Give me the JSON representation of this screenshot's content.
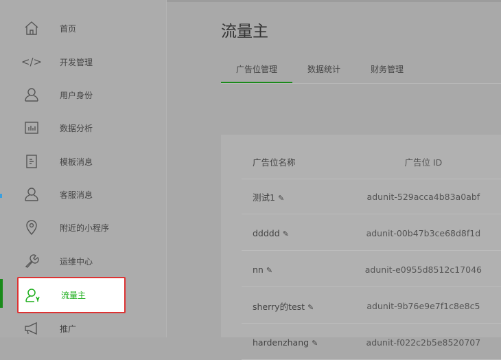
{
  "sidebar": {
    "items": [
      {
        "label": "首页",
        "icon": "home-icon"
      },
      {
        "label": "开发管理",
        "icon": "code-icon"
      },
      {
        "label": "用户身份",
        "icon": "user-icon"
      },
      {
        "label": "数据分析",
        "icon": "chart-icon"
      },
      {
        "label": "模板消息",
        "icon": "document-icon"
      },
      {
        "label": "客服消息",
        "icon": "service-icon"
      },
      {
        "label": "附近的小程序",
        "icon": "location-icon"
      },
      {
        "label": "运维中心",
        "icon": "wrench-icon"
      },
      {
        "label": "流量主",
        "icon": "traffic-user-icon",
        "active": true
      },
      {
        "label": "推广",
        "icon": "megaphone-icon"
      }
    ]
  },
  "main": {
    "title": "流量主",
    "tabs": [
      {
        "label": "广告位管理"
      },
      {
        "label": "数据统计"
      },
      {
        "label": "财务管理"
      }
    ],
    "table": {
      "headers": [
        "广告位名称",
        "广告位 ID"
      ],
      "rows": [
        {
          "name": "测试1",
          "id": "adunit-529acca4b83a0abf"
        },
        {
          "name": "ddddd",
          "id": "adunit-00b47b3ce68d8f1d"
        },
        {
          "name": "nn",
          "id": "adunit-e0955d8512c17046"
        },
        {
          "name": "sherry的test",
          "id": "adunit-9b76e9e7f1c8e8c5"
        },
        {
          "name": "hardenzhang",
          "id": "adunit-f022c2b5e8520707"
        }
      ]
    }
  }
}
